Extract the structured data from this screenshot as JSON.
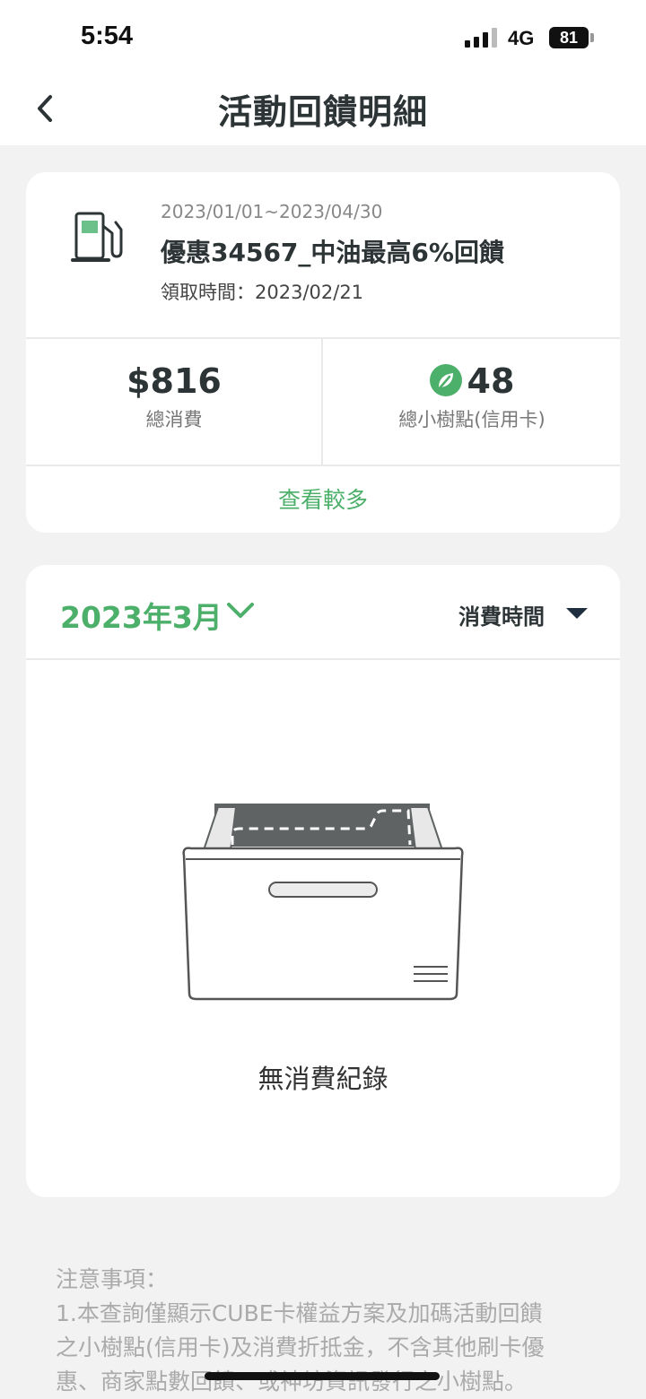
{
  "status_bar": {
    "time": "5:54",
    "network": "4G",
    "battery": "81"
  },
  "nav": {
    "title": "活動回饋明細"
  },
  "promotion": {
    "date_range": "2023/01/01~2023/04/30",
    "title": "優惠34567_中油最高6%回饋",
    "receive_time": "領取時間：2023/02/21",
    "icon": "gas-pump-icon"
  },
  "stats": {
    "total_spend_value": "$816",
    "total_spend_label": "總消費",
    "points_value": "48",
    "points_label": "總小樹點(信用卡)"
  },
  "more_label": "查看較多",
  "filters": {
    "month": "2023年3月",
    "sort": "消費時間"
  },
  "empty_state": {
    "text": "無消費紀錄"
  },
  "notes": {
    "heading": "注意事項：",
    "line1": "1.本查詢僅顯示CUBE卡權益方案及加碼活動回饋",
    "line2": "之小樹點(信用卡)及消費折抵金，不含其他刷卡優",
    "line3": "惠、商家點數回饋、或神坊資訊發行之小樹點。"
  },
  "colors": {
    "accent_green": "#4caf6a",
    "title_dark": "#2d3436"
  }
}
